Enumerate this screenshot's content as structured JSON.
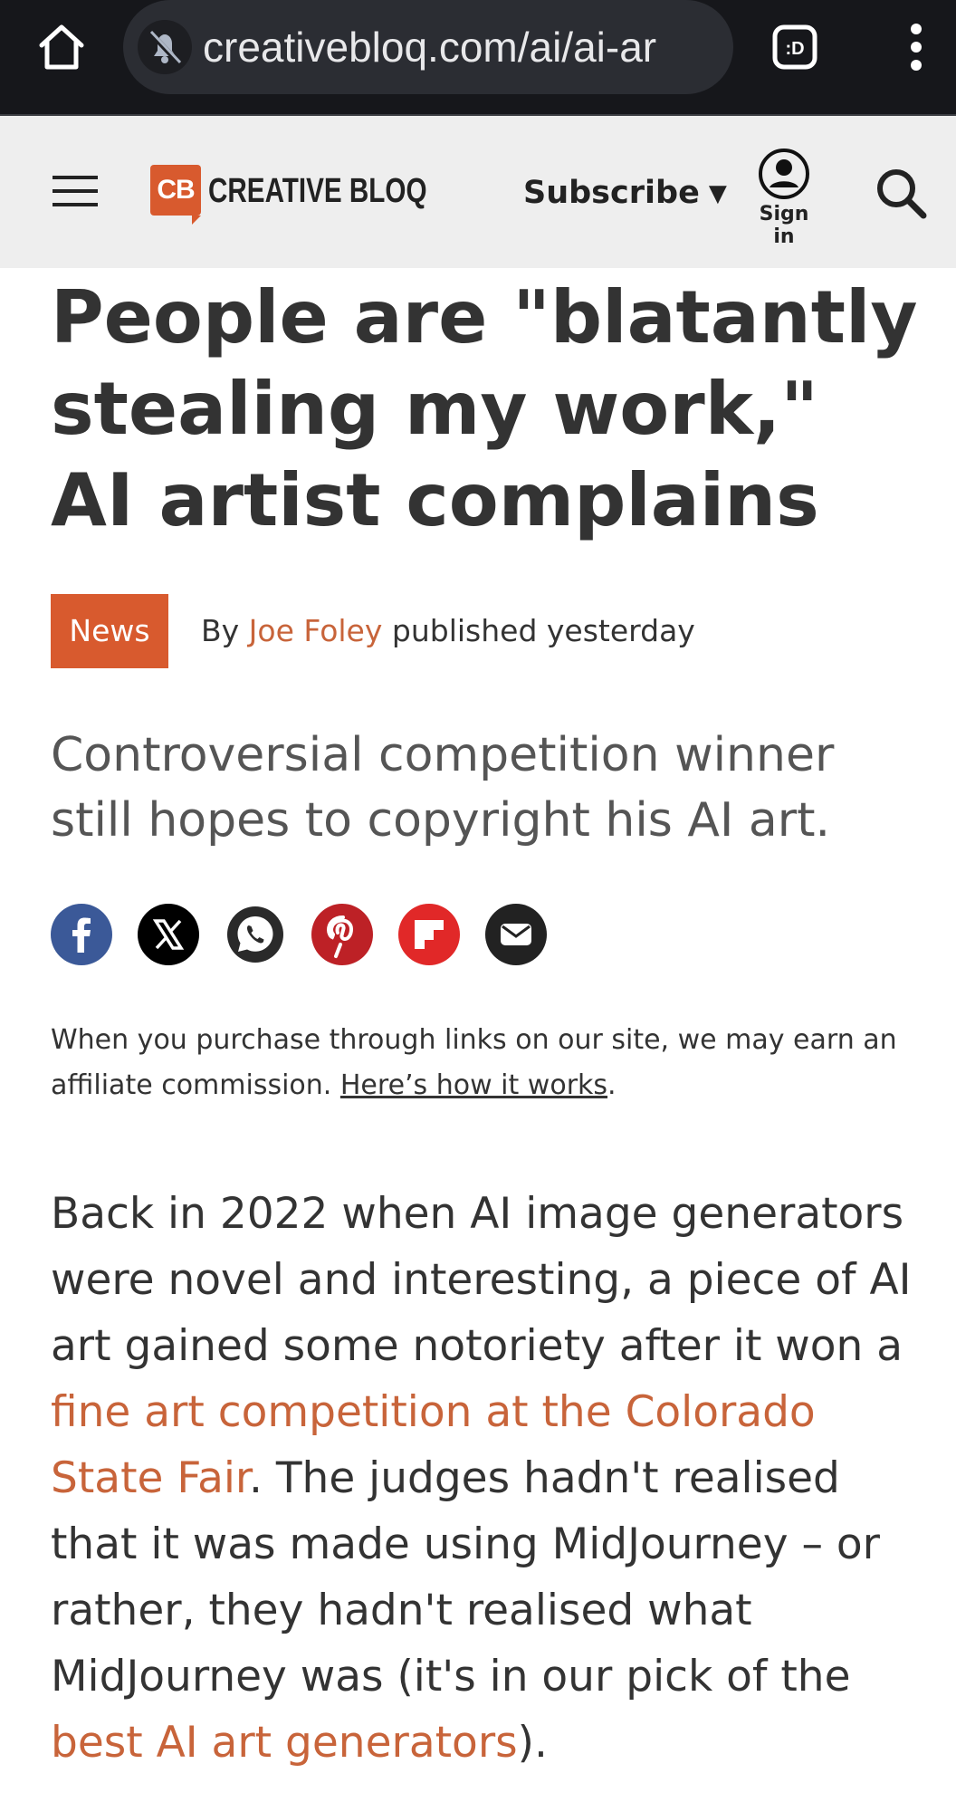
{
  "browser": {
    "url": "creativebloq.com/ai/ai-ar",
    "tabs_label": ":D"
  },
  "header": {
    "logo_mark": "CB",
    "logo_text": "CREATIVE BLOQ",
    "subscribe_label": "Subscribe",
    "signin_label": "Sign in"
  },
  "article": {
    "headline": "People are \"blatantly stealing my work,\" AI artist complains",
    "category_badge": "News",
    "byline_prefix": "By",
    "author": "Joe Foley",
    "published": "published yesterday",
    "strapline": "Controversial competition winner still hopes to copyright his AI art.",
    "affiliate_text": "When you purchase through links on our site, we may earn an affiliate commission.",
    "affiliate_link": "Here’s how it works",
    "affiliate_end": ".",
    "body": {
      "p1_part1": "Back in 2022 when AI image generators were novel and interesting, a piece of AI art gained some notoriety after it won a ",
      "link1": "fine art competition at the Colorado State Fair",
      "p1_part2": ". The judges hadn't realised that it was made using MidJourney – or rather, they hadn't realised what MidJourney was (it's in our pick of the ",
      "link2": "best AI art generators",
      "p1_part3": ")."
    }
  },
  "share_icons": [
    "facebook-icon",
    "x-icon",
    "whatsapp-icon",
    "pinterest-icon",
    "flipboard-icon",
    "email-icon"
  ],
  "colors": {
    "accent": "#d85a2e",
    "link": "#c8643a",
    "facebook": "#3b5998",
    "pinterest": "#bd2126",
    "flipboard": "#e12828",
    "chrome_bg": "#16171b"
  }
}
